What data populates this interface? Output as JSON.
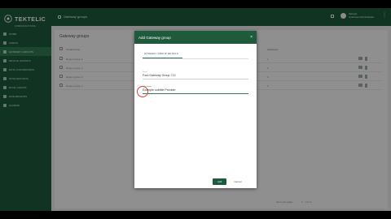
{
  "brand": {
    "name": "TEKTELIC",
    "tagline": "COMMUNICATIONS"
  },
  "sidebar": {
    "items": [
      {
        "label": "Home"
      },
      {
        "label": "Users"
      },
      {
        "label": "Gateway groups"
      },
      {
        "label": "Device groups"
      },
      {
        "label": "Data converters"
      },
      {
        "label": "Integrations"
      },
      {
        "label": "Rule chains"
      },
      {
        "label": "Dashboards"
      },
      {
        "label": "Alarms"
      }
    ]
  },
  "topbar": {
    "title": "Gateway groups",
    "user_line1": "Sample",
    "user_line2": "Customer Administrator"
  },
  "content": {
    "heading": "Gateway groups",
    "columns": {
      "name": "Created time",
      "count": "Gateways"
    },
    "rows": [
      {
        "name": "Region group 1",
        "count": "1"
      },
      {
        "name": "Region group 2",
        "count": "0"
      },
      {
        "name": "Region group 3",
        "count": "0"
      },
      {
        "name": "Region group 4",
        "count": "0"
      }
    ],
    "pager": {
      "items_per_page": "Items per page:",
      "range": "1 – 4 of 4"
    }
  },
  "dialog": {
    "title": "Add Gateway group",
    "close": "×",
    "tab": "Gateway group details",
    "fields": [
      {
        "label": "Name*",
        "value": "Ford Gateway Group 713"
      },
      {
        "label": "Description",
        "value": "Example subtitle Provider"
      }
    ],
    "buttons": {
      "add": "Add",
      "cancel": "Cancel"
    }
  }
}
